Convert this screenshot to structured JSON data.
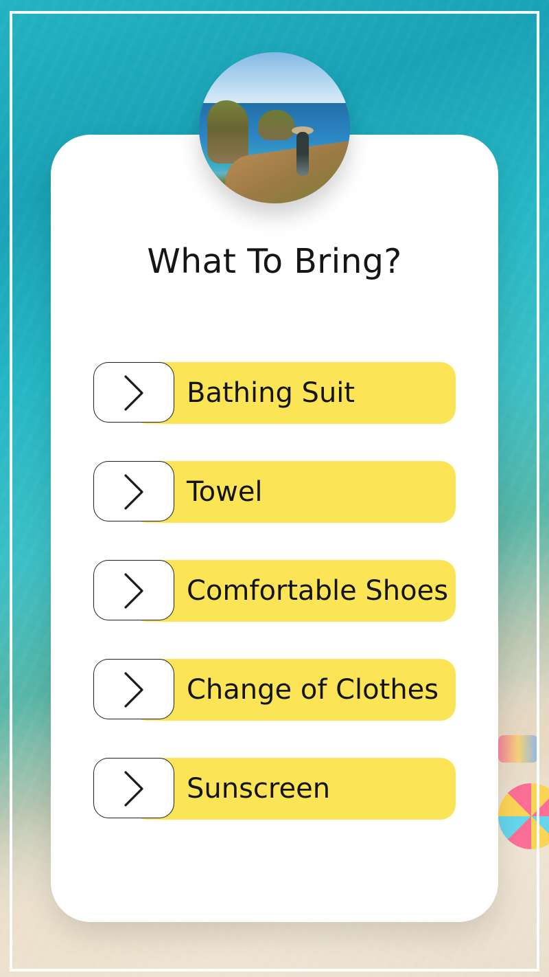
{
  "title": "What To Bring?",
  "items": [
    {
      "label": "Bathing Suit",
      "icon": "chevron-right-icon"
    },
    {
      "label": "Towel",
      "icon": "chevron-right-icon"
    },
    {
      "label": "Comfortable Shoes",
      "icon": "chevron-right-icon"
    },
    {
      "label": "Change of Clothes",
      "icon": "chevron-right-icon"
    },
    {
      "label": "Sunscreen",
      "icon": "chevron-right-icon"
    }
  ],
  "colors": {
    "accent": "#fbe556",
    "card": "#ffffff",
    "text": "#151515"
  },
  "background_image": "beach-shoreline",
  "header_image": "coastal-cliffs-person"
}
